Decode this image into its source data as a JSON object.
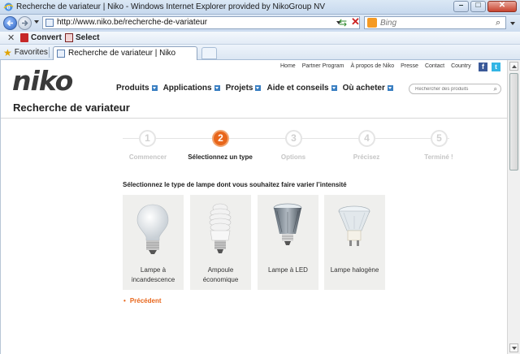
{
  "window": {
    "title": "Recherche de variateur | Niko - Windows Internet Explorer provided by NikoGroup NV",
    "buttons": [
      "–",
      "□",
      "✕"
    ]
  },
  "address_bar": {
    "url": "http://www.niko.be/recherche-de-variateur",
    "search_placeholder": "Bing"
  },
  "command_bar": {
    "convert_label": "Convert",
    "select_label": "Select"
  },
  "favorites_bar": {
    "favorites_label": "Favorites",
    "tab_label": "Recherche de variateur | Niko"
  },
  "site": {
    "logo": "niko",
    "top_nav": [
      "Home",
      "Partner Program",
      "À propos de Niko",
      "Presse",
      "Contact",
      "Country"
    ],
    "social": [
      "f",
      "t"
    ],
    "main_nav": [
      "Produits",
      "Applications",
      "Projets",
      "Aide et conseils",
      "Où acheter"
    ],
    "search_placeholder": "Rechercher des produits"
  },
  "page": {
    "title": "Recherche de variateur",
    "steps": [
      {
        "number": "1",
        "label": "Commencer"
      },
      {
        "number": "2",
        "label": "Sélectionnez un type"
      },
      {
        "number": "3",
        "label": "Options"
      },
      {
        "number": "4",
        "label": "Précisez"
      },
      {
        "number": "5",
        "label": "Terminé !"
      }
    ],
    "active_step": 2,
    "instruction": "Sélectionnez le type de lampe dont vous souhaitez faire varier l’intensité",
    "lamp_cards": [
      {
        "label_line1": "Lampe à",
        "label_line2": "incandescence",
        "icon": "incandescent-bulb-icon"
      },
      {
        "label_line1": "Ampoule",
        "label_line2": "économique",
        "icon": "energy-saving-bulb-icon"
      },
      {
        "label_line1": "Lampe à LED",
        "label_line2": "",
        "icon": "led-bulb-icon"
      },
      {
        "label_line1": "Lampe halogène",
        "label_line2": "",
        "icon": "halogen-bulb-icon"
      }
    ],
    "previous_label": "Précédent",
    "previous_bullet": "•"
  },
  "colors": {
    "accent_orange": "#e8661b",
    "nav_blue": "#3a7fc2",
    "card_bg": "#efefed"
  }
}
